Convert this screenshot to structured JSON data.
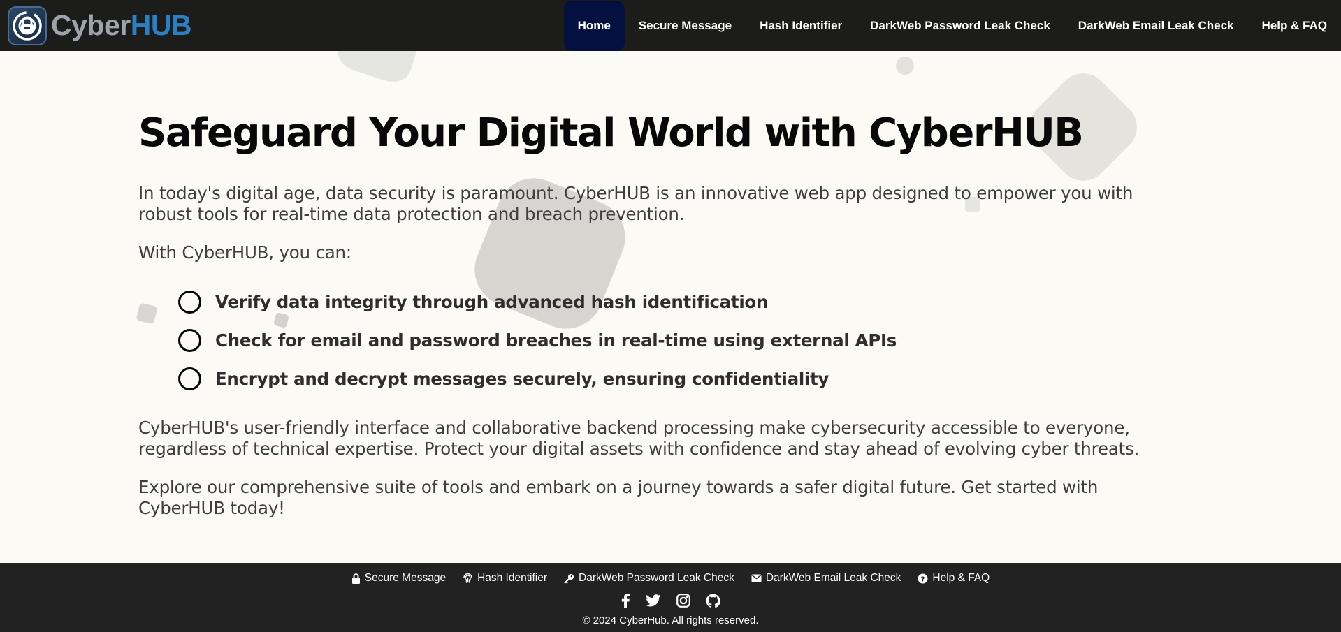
{
  "brand": {
    "name_part1": "Cyber",
    "name_part2": "HUB",
    "logo_icon": "lock-shield-icon"
  },
  "nav": {
    "items": [
      {
        "label": "Home",
        "active": true
      },
      {
        "label": "Secure Message"
      },
      {
        "label": "Hash Identifier"
      },
      {
        "label": "DarkWeb Password Leak Check"
      },
      {
        "label": "DarkWeb Email Leak Check"
      },
      {
        "label": "Help & FAQ"
      }
    ]
  },
  "main": {
    "title": "Safeguard Your Digital World with CyberHUB",
    "intro": "In today's digital age, data security is paramount. CyberHUB is an innovative web app designed to empower you with robust tools for real-time data protection and breach prevention.",
    "with_you_can": "With CyberHUB, you can:",
    "features": [
      "Verify data integrity through advanced hash identification",
      "Check for email and password breaches in real-time using external APIs",
      "Encrypt and decrypt messages securely, ensuring confidentiality"
    ],
    "paragraph_2": "CyberHUB's user-friendly interface and collaborative backend processing make cybersecurity accessible to everyone, regardless of technical expertise. Protect your digital assets with confidence and stay ahead of evolving cyber threats.",
    "paragraph_3": "Explore our comprehensive suite of tools and embark on a journey towards a safer digital future. Get started with CyberHUB today!"
  },
  "footer": {
    "links": [
      {
        "label": "Secure Message",
        "icon": "lock-icon"
      },
      {
        "label": "Hash Identifier",
        "icon": "fingerprint-icon"
      },
      {
        "label": "DarkWeb Password Leak Check",
        "icon": "key-icon"
      },
      {
        "label": "DarkWeb Email Leak Check",
        "icon": "envelope-icon"
      },
      {
        "label": "Help & FAQ",
        "icon": "question-circle-icon"
      }
    ],
    "social": [
      "facebook-icon",
      "twitter-icon",
      "instagram-icon",
      "github-icon"
    ],
    "copyright": "© 2024 CyberHub. All rights reserved."
  },
  "colors": {
    "navbar_bg": "#1c1c1b",
    "active_nav_bg": "#04103f",
    "page_bg": "#fbfaf4",
    "footer_bg": "#222222",
    "brand_accent": "#2d7fc4",
    "brand_grey": "#9ea3ab"
  }
}
